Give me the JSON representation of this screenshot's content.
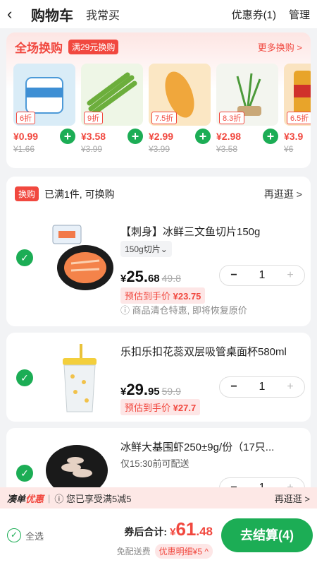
{
  "header": {
    "back_icon": "chevron-left-icon",
    "title": "购物车",
    "tab_frequent": "我常买",
    "coupons": "优惠券(1)",
    "manage": "管理"
  },
  "promo": {
    "title": "全场换购",
    "badge": "满29元换购",
    "more": "更多换购 >",
    "products": [
      {
        "discount": "6折",
        "price": "¥0.99",
        "old": "¥1.66",
        "color": "#d9ecf7"
      },
      {
        "discount": "9折",
        "price": "¥3.58",
        "old": "¥3.99",
        "color": "#a9d27a"
      },
      {
        "discount": "7.5折",
        "price": "¥2.99",
        "old": "¥3.99",
        "color": "#f2b14a"
      },
      {
        "discount": "8.3折",
        "price": "¥2.98",
        "old": "¥3.58",
        "color": "#e9efe2"
      },
      {
        "discount": "6.5折",
        "price": "¥3.9",
        "old": "¥6",
        "color": "#e8a42a"
      }
    ]
  },
  "exchange": {
    "tag": "换购",
    "text": "已满1件, 可换购",
    "more": "再逛逛 >"
  },
  "items": [
    {
      "name": "【刺身】冰鲜三文鱼切片150g",
      "spec": "150g切片⌄",
      "currency": "¥",
      "price_int": "25.",
      "price_dec": "68",
      "old": "49.8",
      "est_label": "预估到手价",
      "est_value": "¥23.75",
      "note": "ⓘ 商品清仓特惠, 即将恢复原价",
      "qty": "1"
    },
    {
      "name": "乐扣乐扣花蕊双层吸管桌面杯580ml",
      "currency": "¥",
      "price_int": "29.",
      "price_dec": "95",
      "old": "59.9",
      "est_label": "预估到手价",
      "est_value": "¥27.7",
      "qty": "1"
    },
    {
      "name": "冰鲜大基围虾250±9g/份（17只...",
      "subtitle": "仅15:30前可配送",
      "qty": "1"
    }
  ],
  "discount_bar": {
    "title_a": "凑单",
    "title_b": "优惠",
    "text": "ⓘ 您已享受满5减5",
    "more": "再逛逛 >"
  },
  "bottom": {
    "select_all": "全选",
    "total_label": "券后合计:",
    "currency": "¥",
    "total_int": "61",
    "total_dec": ".48",
    "free_shipping": "免配送费",
    "discount_detail": "优惠明细¥5 ^",
    "checkout": "去结算(4)"
  }
}
